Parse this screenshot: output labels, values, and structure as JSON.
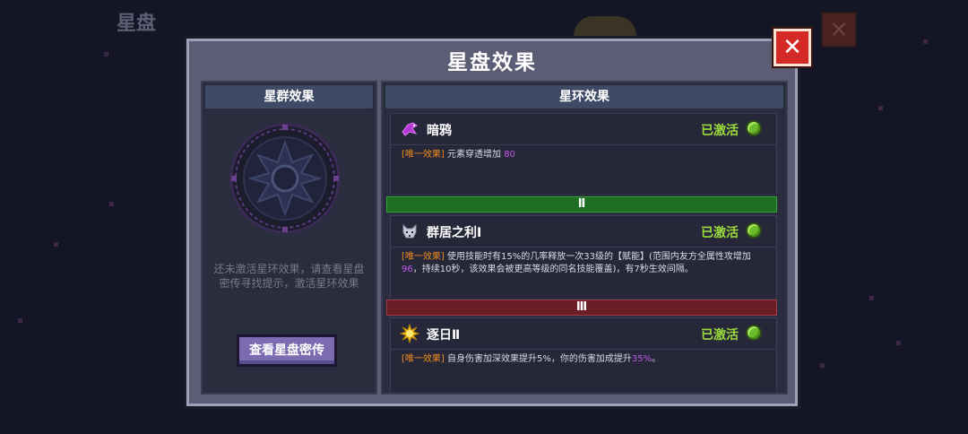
{
  "background": {
    "title": "星盘",
    "close_symbol": "✕"
  },
  "modal": {
    "title": "星盘效果",
    "close_symbol": "✕"
  },
  "left_panel": {
    "header": "星群效果",
    "hint": "还未激活星环效果，请查看星盘密传寻找提示，激活星环效果",
    "button_label": "查看星盘密传",
    "disc_icon": "star-disc-icon"
  },
  "right_panel": {
    "header": "星环效果",
    "effects": [
      {
        "icon": "raven-icon",
        "name": "暗鸦",
        "status": "已激活",
        "tag": "[唯一效果]",
        "desc_parts": [
          "元素穿透增加 ",
          "80",
          ""
        ]
      },
      {
        "icon": "wolf-icon",
        "name": "群居之利Ⅰ",
        "status": "已激活",
        "tag": "[唯一效果]",
        "desc_parts": [
          "使用技能时有15%的几率释放一次33级的【赋能】(范围内友方全属性攻增加",
          "96",
          "，持续10秒，该效果会被更高等级的同名技能覆盖)，有7秒生效间隔。"
        ]
      },
      {
        "icon": "sun-icon",
        "name": "逐日Ⅱ",
        "status": "已激活",
        "tag": "[唯一效果]",
        "desc_parts": [
          "自身伤害加深效果提升5%，你的伤害加成提升",
          "35%",
          "。"
        ]
      }
    ],
    "dividers": [
      "Ⅱ",
      "Ⅲ"
    ]
  },
  "colors": {
    "active_status": "#9bdc3a",
    "tag": "#f08a1c",
    "highlight_number": "#c35ae8",
    "divider_2": "#1d6e22",
    "divider_3": "#6b1e26",
    "close_button": "#d32a26",
    "lore_button": "#7b6bb0"
  }
}
